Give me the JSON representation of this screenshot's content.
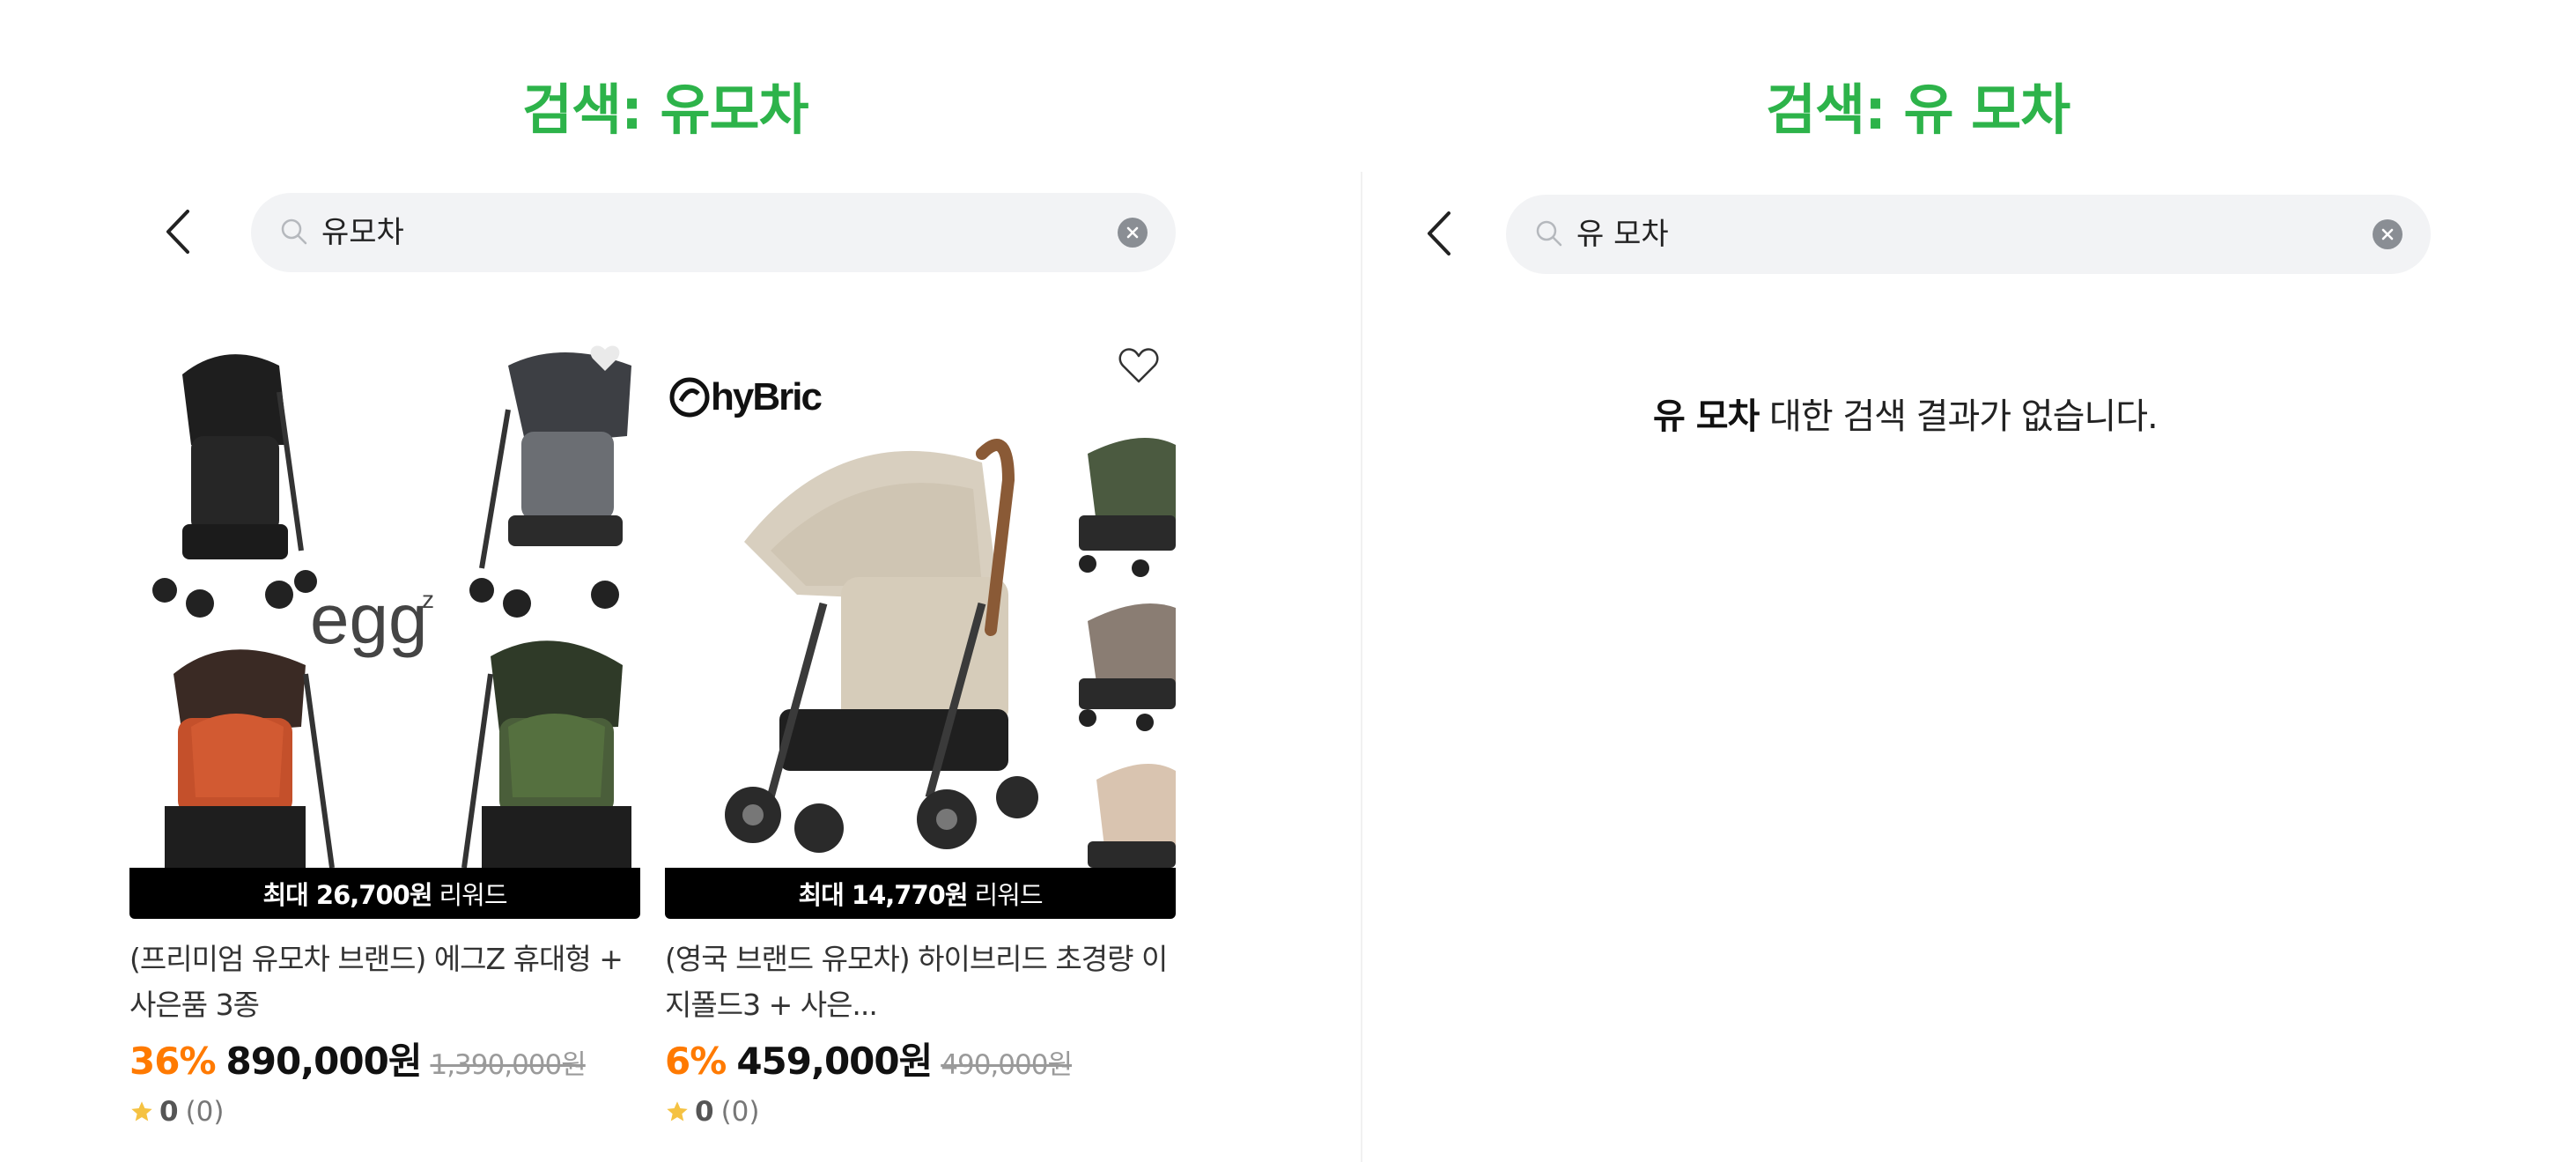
{
  "left_panel": {
    "title": "검색: 유모차",
    "search": {
      "value": "유모차"
    },
    "products": [
      {
        "reward_amount": "최대 26,700원",
        "reward_suffix": "리워드",
        "title": "(프리미엄 유모차 브랜드) 에그Z 휴대형 + 사은품 3종",
        "discount": "36%",
        "price": "890,000원",
        "original_price": "1,390,000원",
        "rating": "0",
        "review_count": "(0)",
        "image_text": "eggz"
      },
      {
        "reward_amount": "최대 14,770원",
        "reward_suffix": "리워드",
        "title": "(영국 브랜드 유모차) 하이브리드 초경량 이지폴드3 + 사은...",
        "discount": "6%",
        "price": "459,000원",
        "original_price": "490,000원",
        "rating": "0",
        "review_count": "(0)",
        "image_text": "hyBric"
      }
    ]
  },
  "right_panel": {
    "title": "검색: 유 모차",
    "search": {
      "value": "유 모차"
    },
    "no_result": {
      "keyword": "유 모차",
      "message": "대한 검색 결과가 없습니다."
    }
  },
  "colors": {
    "title_green": "#2db34a",
    "discount_orange": "#ff7a00",
    "star": "#f5c242"
  },
  "icons": [
    "back-icon",
    "search-icon",
    "clear-icon",
    "heart-icon",
    "star-icon"
  ]
}
